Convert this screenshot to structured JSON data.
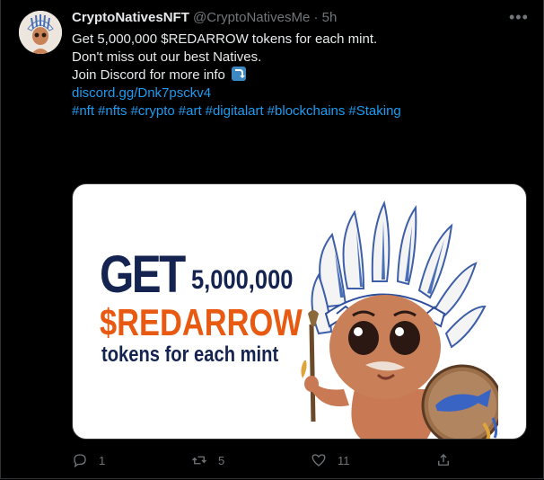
{
  "tweet": {
    "display_name": "CryptoNativesNFT",
    "handle": "@CryptoNativesMe",
    "separator": "·",
    "time": "5h",
    "more": "•••",
    "text": {
      "line1": "Get 5,000,000 $REDARROW tokens for each mint.",
      "line2": "Don't miss out our best Natives.",
      "line3": "Join Discord for more info",
      "link": "discord.gg/Dnk7psckv4",
      "hashtags": [
        "#nft",
        "#nfts",
        "#crypto",
        "#art",
        "#digitalart",
        "#blockchains",
        "#Staking"
      ]
    },
    "media": {
      "get": "GET",
      "amount": "5,000,000",
      "token": "$REDARROW",
      "tagline": "tokens for each mint"
    },
    "actions": {
      "reply_count": "1",
      "retweet_count": "5",
      "like_count": "11"
    }
  },
  "colors": {
    "background": "#000000",
    "link": "#1d9bf0",
    "muted": "#71767b",
    "navy": "#14234f",
    "orange": "#e85a12"
  }
}
